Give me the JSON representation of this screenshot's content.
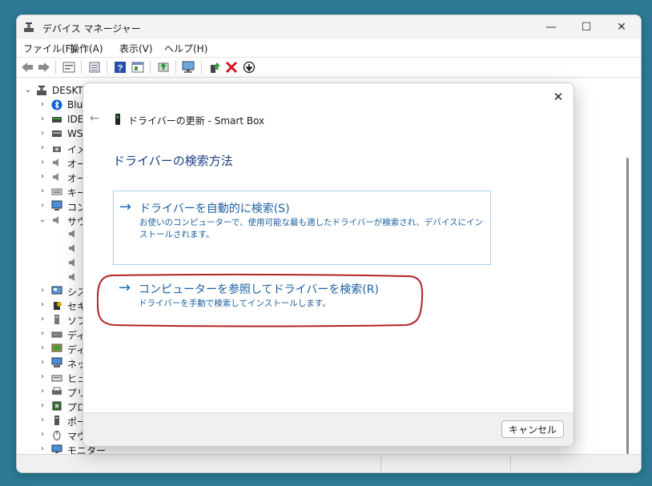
{
  "window": {
    "title": "デバイス マネージャー",
    "controls": {
      "minimize": "—",
      "maximize": "☐",
      "close": "✕"
    }
  },
  "menu": [
    "ファイル(F)",
    "操作(A)",
    "表示(V)",
    "ヘルプ(H)"
  ],
  "toolbar_icons": [
    "back-icon",
    "forward-icon",
    "properties-icon",
    "show-hidden-icon",
    "help-icon",
    "action-icon",
    "update-driver-icon",
    "scan-hardware-icon",
    "enable-device-icon",
    "uninstall-icon",
    "disable-device-icon"
  ],
  "tree": {
    "root": "DESKTO",
    "items": [
      {
        "label": "Blue",
        "icon": "bluetooth-icon"
      },
      {
        "label": "IDE",
        "icon": "ide-icon"
      },
      {
        "label": "WSI",
        "icon": "wsd-icon"
      },
      {
        "label": "イメ",
        "icon": "imaging-icon"
      },
      {
        "label": "オー",
        "icon": "audio-icon"
      },
      {
        "label": "オー",
        "icon": "audio-icon"
      },
      {
        "label": "キー",
        "icon": "keyboard-icon"
      },
      {
        "label": "コン",
        "icon": "computer-icon"
      },
      {
        "label": "サウ",
        "icon": "sound-icon"
      },
      {
        "label": "シス",
        "icon": "system-icon"
      },
      {
        "label": "セキ",
        "icon": "security-icon"
      },
      {
        "label": "ソフ",
        "icon": "software-icon"
      },
      {
        "label": "ディ",
        "icon": "disk-icon"
      },
      {
        "label": "ディ",
        "icon": "display-icon"
      },
      {
        "label": "ネッ",
        "icon": "network-icon"
      },
      {
        "label": "ヒュ",
        "icon": "hid-icon"
      },
      {
        "label": "プリ",
        "icon": "printer-icon"
      },
      {
        "label": "プロ",
        "icon": "processor-icon"
      },
      {
        "label": "ポー",
        "icon": "port-icon"
      },
      {
        "label": "マウ",
        "icon": "mouse-icon"
      },
      {
        "label": "モニター",
        "icon": "monitor-icon"
      }
    ]
  },
  "dialog": {
    "close": "✕",
    "back": "←",
    "title": "ドライバーの更新 - Smart Box",
    "heading": "ドライバーの検索方法",
    "option_auto": {
      "arrow": "→",
      "title": "ドライバーを自動的に検索(S)",
      "description": "お使いのコンピューターで、使用可能な最も適したドライバーが検索され、デバイスにインストールされます。"
    },
    "option_browse": {
      "arrow": "→",
      "title": "コンピューターを参照してドライバーを検索(R)",
      "description": "ドライバーを手動で検索してインストールします。"
    },
    "cancel_label": "キャンセル"
  },
  "colors": {
    "accent": "#1c5fa0",
    "highlight_ring": "#b22222",
    "desktop": "#2c7a95"
  }
}
